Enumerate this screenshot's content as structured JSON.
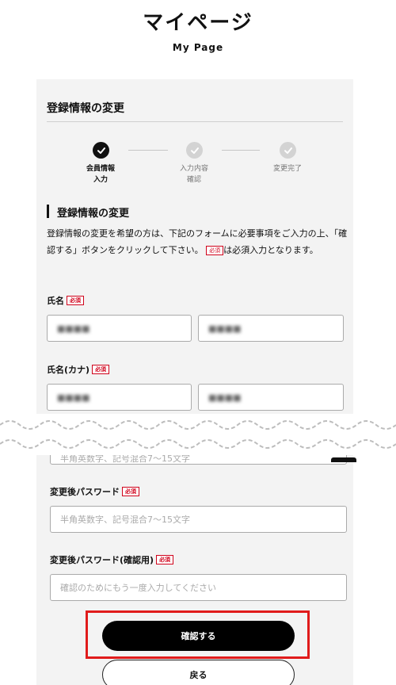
{
  "header": {
    "title": "マイページ",
    "subtitle": "My Page"
  },
  "panel": {
    "heading": "登録情報の変更"
  },
  "steps": [
    {
      "label_line1": "会員情報",
      "label_line2": "入力",
      "state": "done"
    },
    {
      "label_line1": "入力内容",
      "label_line2": "確認",
      "state": "todo"
    },
    {
      "label_line1": "変更完了",
      "label_line2": "",
      "state": "todo"
    }
  ],
  "section": {
    "title": "登録情報の変更",
    "intro_before": "登録情報の変更を希望の方は、下記のフォームに必要事項をご入力の上、「確認する」ボタンをクリックして下さい。",
    "intro_after": "は必須入力となります。"
  },
  "required_badge": "必須",
  "fields": {
    "name": {
      "label": "氏名",
      "last_value": "■■■■",
      "first_value": "■■■■"
    },
    "name_kana": {
      "label": "氏名(カナ)",
      "last_value": "■■■■",
      "first_value": "■■■■"
    },
    "current_password": {
      "placeholder": "半角英数字、記号混合7〜15文字"
    },
    "new_password": {
      "label": "変更後パスワード",
      "placeholder": "半角英数字、記号混合7〜15文字"
    },
    "new_password_confirm": {
      "label": "変更後パスワード(確認用)",
      "placeholder": "確認のためにもう一度入力してください"
    }
  },
  "buttons": {
    "confirm": "確認する",
    "back": "戻る"
  },
  "colors": {
    "accent": "#d0021b",
    "highlight": "#e01b1b",
    "panel_bg": "#f3f3f3"
  },
  "icons": {
    "step_done": "check-icon",
    "step_todo": "check-icon"
  }
}
